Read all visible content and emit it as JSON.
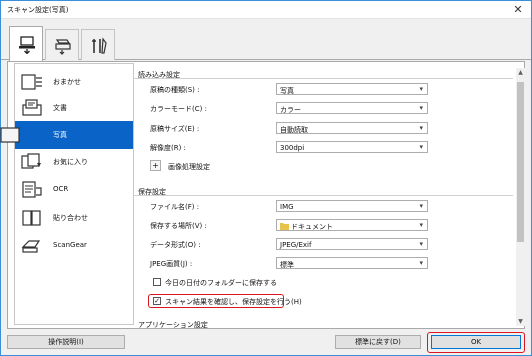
{
  "window": {
    "title": "スキャン設定(写真)"
  },
  "tabs": [
    {
      "name": "scan-from-computer",
      "icon": "computer-scan-icon",
      "active": true
    },
    {
      "name": "scan-from-panel",
      "icon": "scanner-panel-icon",
      "active": false
    },
    {
      "name": "general-settings",
      "icon": "tools-icon",
      "active": false
    }
  ],
  "sidebar": {
    "items": [
      {
        "label": "おまかせ",
        "icon": "auto-scan-icon"
      },
      {
        "label": "文書",
        "icon": "document-icon"
      },
      {
        "label": "写真",
        "icon": "photo-icon",
        "selected": true
      },
      {
        "label": "お気に入り",
        "icon": "favorites-icon"
      },
      {
        "label": "OCR",
        "icon": "ocr-icon"
      },
      {
        "label": "貼り合わせ",
        "icon": "stitch-icon"
      },
      {
        "label": "ScanGear",
        "icon": "scangear-icon"
      }
    ]
  },
  "scan_options": {
    "section_title": "読み込み設定",
    "source_label": "原稿の種類(S) :",
    "source_value": "写真",
    "color_mode_label": "カラーモード(C) :",
    "color_mode_value": "カラー",
    "paper_size_label": "原稿サイズ(E) :",
    "paper_size_value": "自動読取",
    "resolution_label": "解像度(R) :",
    "resolution_value": "300dpi",
    "image_processing_label": "画像処理設定"
  },
  "save_settings": {
    "section_title": "保存設定",
    "file_name_label": "ファイル名(F) :",
    "file_name_value": "IMG",
    "save_in_label": "保存する場所(V) :",
    "save_in_value": "ドキュメント",
    "data_format_label": "データ形式(O) :",
    "data_format_value": "JPEG/Exif",
    "jpeg_quality_label": "JPEG画質(J) :",
    "jpeg_quality_value": "標準",
    "subfolder_label": "今日の日付のフォルダーに保存する",
    "subfolder_checked": false,
    "confirm_label": "スキャン結果を確認し、保存設定を行う(H)",
    "confirm_checked": true
  },
  "app_settings": {
    "section_title": "アプリケーション設定"
  },
  "footer": {
    "instructions_label": "操作説明(I)",
    "defaults_label": "標準に戻す(D)",
    "ok_label": "OK"
  },
  "colors": {
    "selection": "#0a64c8",
    "highlight": "#e0141e",
    "focus_border": "#0078d7"
  }
}
